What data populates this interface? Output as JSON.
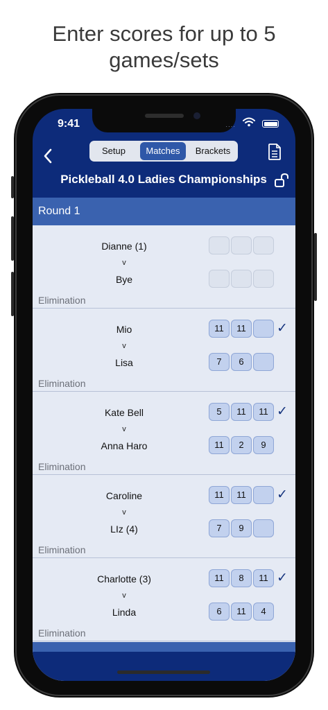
{
  "caption": {
    "line1": "Enter scores for up to 5",
    "line2": "games/sets"
  },
  "status_bar": {
    "time": "9:41",
    "signal": "····"
  },
  "nav": {
    "tabs": [
      {
        "label": "Setup",
        "active": false
      },
      {
        "label": "Matches",
        "active": true
      },
      {
        "label": "Brackets",
        "active": false
      }
    ],
    "back_icon": "chevron-left-icon",
    "doc_icon": "document-icon"
  },
  "tournament": {
    "title": "Pickleball 4.0 Ladies Championships",
    "lock_icon": "unlocked-lock-icon"
  },
  "round": {
    "title": "Round 1"
  },
  "vs_label": "v",
  "matches": [
    {
      "p1": "Dianne (1)",
      "p2": "Bye",
      "type": "Elimination",
      "p1_scores": [
        "",
        "",
        ""
      ],
      "p2_scores": [
        "",
        "",
        ""
      ],
      "complete": false,
      "check": ""
    },
    {
      "p1": "Mio",
      "p2": "Lisa",
      "type": "Elimination",
      "p1_scores": [
        "11",
        "11",
        ""
      ],
      "p2_scores": [
        "7",
        "6",
        ""
      ],
      "complete": true,
      "check": "✓"
    },
    {
      "p1": "Kate Bell",
      "p2": "Anna Haro",
      "type": "Elimination",
      "p1_scores": [
        "5",
        "11",
        "11"
      ],
      "p2_scores": [
        "11",
        "2",
        "9"
      ],
      "complete": true,
      "check": "✓"
    },
    {
      "p1": "Caroline",
      "p2": "LIz (4)",
      "type": "Elimination",
      "p1_scores": [
        "11",
        "11",
        ""
      ],
      "p2_scores": [
        "7",
        "9",
        ""
      ],
      "complete": true,
      "check": "✓"
    },
    {
      "p1": "Charlotte (3)",
      "p2": "Linda",
      "type": "Elimination",
      "p1_scores": [
        "11",
        "8",
        "11"
      ],
      "p2_scores": [
        "6",
        "11",
        "4"
      ],
      "complete": true,
      "check": "✓"
    }
  ],
  "colors": {
    "nav_bg": "#0d2b7a",
    "accent": "#2f58a8",
    "round_header": "#3a62af",
    "list_bg": "#e5eaf4",
    "check": "#17357e"
  }
}
